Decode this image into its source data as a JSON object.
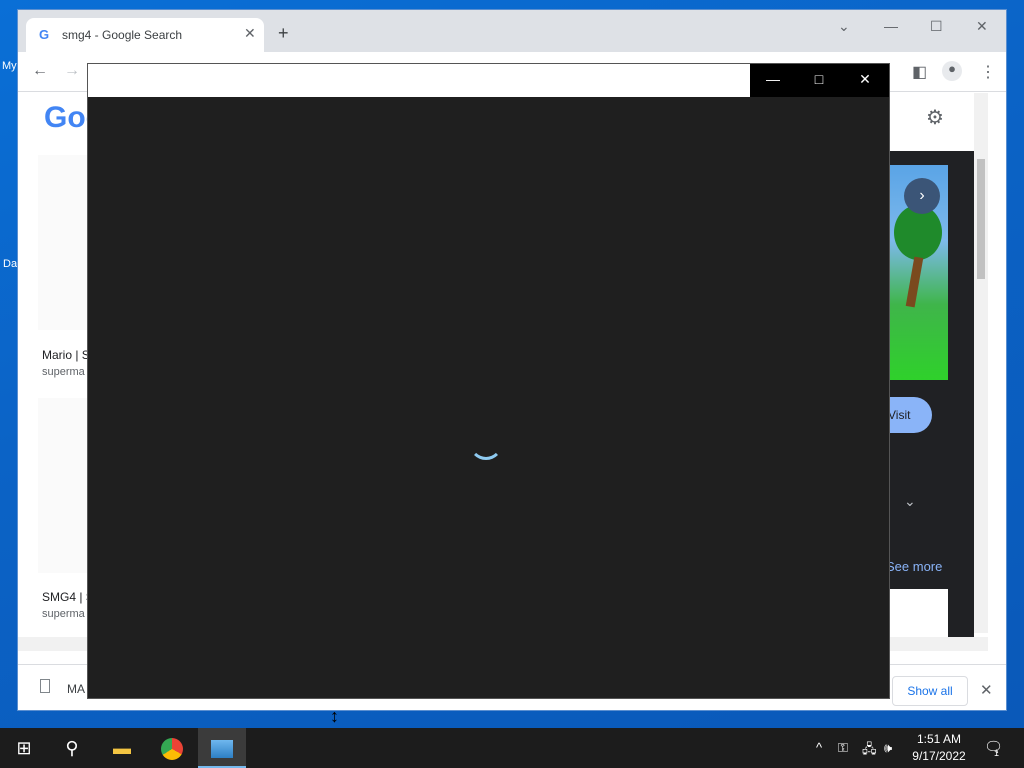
{
  "desktop": {
    "labels": [
      "My",
      "Da"
    ]
  },
  "chrome": {
    "tab_title": "smg4 - Google Search",
    "tab_favicon": "G",
    "new_tab_label": "+",
    "window_controls": {
      "minimize": "—",
      "maximize": "☐",
      "close": "✕"
    }
  },
  "page": {
    "logo": "Goo",
    "results": [
      {
        "title": "Mario | S",
        "url": "superma"
      },
      {
        "title": "SMG4 | S",
        "url": "superma"
      }
    ],
    "visit_label": "Visit",
    "see_more_label": "See more"
  },
  "downloads": {
    "file_name": "MA",
    "show_all_label": "Show all"
  },
  "viewer": {
    "controls": {
      "minimize": "—",
      "maximize": "□",
      "close": "✕"
    }
  },
  "taskbar": {
    "time": "1:51 AM",
    "date": "9/17/2022",
    "notification_count": "1"
  },
  "icons": {
    "back": "back-arrow-icon",
    "forward": "forward-arrow-icon",
    "settings": "gear-icon",
    "apps": "apps-grid-icon"
  },
  "colors": {
    "viewer_bg": "#1f1f1f",
    "spinner": "#8ecaf0",
    "taskbar_bg": "#1c1c1c",
    "link_blue": "#1a73e8"
  }
}
